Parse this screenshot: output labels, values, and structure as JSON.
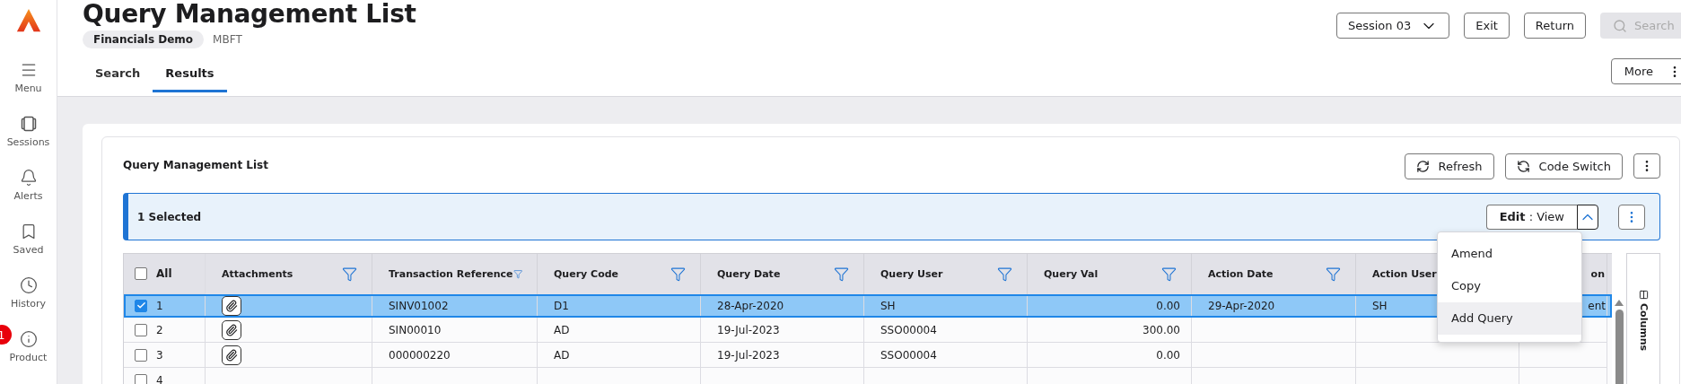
{
  "sidebar": {
    "items": [
      {
        "label": "Menu",
        "kind": "menu"
      },
      {
        "label": "Sessions",
        "kind": "sessions"
      },
      {
        "label": "Alerts",
        "kind": "alerts"
      },
      {
        "label": "Saved",
        "kind": "saved"
      },
      {
        "label": "History",
        "kind": "history"
      },
      {
        "label": "Product",
        "kind": "product",
        "badge": "1"
      }
    ]
  },
  "header": {
    "title": "Query Management List",
    "chip": "Financials Demo",
    "code": "MBFT"
  },
  "tabs": [
    {
      "label": "Search",
      "selected": false
    },
    {
      "label": "Results",
      "selected": true
    }
  ],
  "toolbar": {
    "session": "Session 03",
    "buttons": [
      "Exit",
      "Return"
    ],
    "search": {
      "placeholder": "Search",
      "disabled": true
    },
    "more": "More"
  },
  "panel": {
    "title": "Query Management List",
    "actions": [
      {
        "label": "Refresh",
        "kind": "refresh"
      },
      {
        "label": "Code Switch",
        "kind": "switch"
      }
    ],
    "selection": {
      "text": "1 Selected",
      "edit_button": "**Edit** : View",
      "expanded": true
    },
    "menu": {
      "items": [
        {
          "label": "Amend",
          "selected": false
        },
        {
          "label": "Copy",
          "selected": false
        },
        {
          "label": "Add Query",
          "selected": true
        }
      ]
    },
    "table": {
      "select_all": {
        "label": "All",
        "checked": false
      },
      "columns": [
        {
          "label": "Attachments",
          "filter": true,
          "kind": "icon"
        },
        {
          "label": "Transaction Reference",
          "filter": true,
          "kind": "text"
        },
        {
          "label": "Query Code",
          "filter": true,
          "kind": "text"
        },
        {
          "label": "Query Date",
          "filter": true,
          "kind": "text"
        },
        {
          "label": "Query User",
          "filter": true,
          "kind": "text"
        },
        {
          "label": "Query Val",
          "filter": true,
          "kind": "number"
        },
        {
          "label": "Action Date",
          "filter": true,
          "kind": "text"
        },
        {
          "label": "Action User",
          "filter": false,
          "kind": "text"
        },
        {
          "label": "on",
          "filter": false,
          "kind": "number"
        }
      ],
      "rows": [
        {
          "number": "1",
          "checked": true,
          "selected": true,
          "attachment": true,
          "cells": [
            "",
            "SINV01002",
            "D1",
            "28-Apr-2020",
            "SH",
            "0.00",
            "29-Apr-2020",
            "SH",
            "ent"
          ]
        },
        {
          "number": "2",
          "checked": false,
          "selected": false,
          "attachment": true,
          "cells": [
            "",
            "SIN00010",
            "AD",
            "19-Jul-2023",
            "SSO00004",
            "300.00"
          ]
        },
        {
          "number": "3",
          "checked": false,
          "selected": false,
          "attachment": true,
          "cells": [
            "",
            "000000220",
            "AD",
            "19-Jul-2023",
            "SSO00004",
            "0.00"
          ]
        },
        {
          "number": "4",
          "checked": false,
          "selected": false,
          "attachment": false,
          "cells": []
        }
      ]
    },
    "side_panel": {
      "label": "Columns"
    }
  }
}
